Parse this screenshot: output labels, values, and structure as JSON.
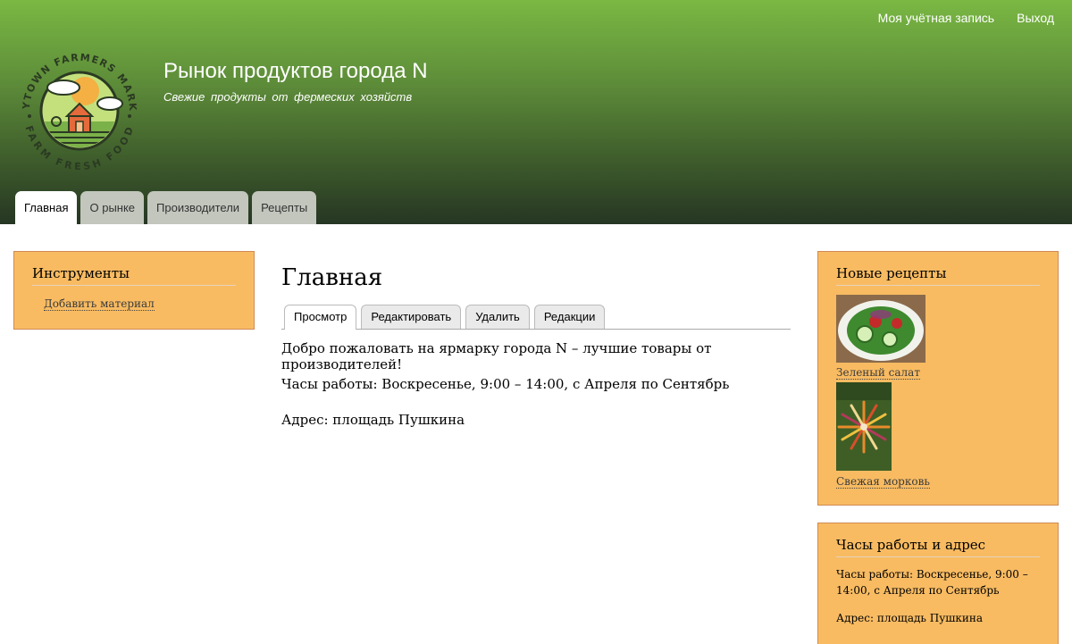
{
  "header": {
    "site_name": "Рынок продуктов города N",
    "slogan": "Свежие продукты от фермеских хозяйств",
    "logo": {
      "top_text": "ANYTOWN FARMERS MARKET",
      "bottom_text": "FARM FRESH FOOD"
    },
    "secondary_menu": [
      {
        "label": "Моя учётная запись"
      },
      {
        "label": "Выход"
      }
    ],
    "main_menu": [
      {
        "label": "Главная",
        "active": true
      },
      {
        "label": "О рынке",
        "active": false
      },
      {
        "label": "Производители",
        "active": false
      },
      {
        "label": "Рецепты",
        "active": false
      }
    ]
  },
  "sidebar_first": {
    "tools": {
      "title": "Инструменты",
      "links": [
        {
          "label": "Добавить материал"
        }
      ]
    }
  },
  "main": {
    "title": "Главная",
    "tabs": [
      {
        "label": "Просмотр",
        "active": true
      },
      {
        "label": "Редактировать",
        "active": false
      },
      {
        "label": "Удалить",
        "active": false
      },
      {
        "label": "Редакции",
        "active": false
      }
    ],
    "paragraphs": [
      "Добро пожаловать на ярмарку города N – лучшие товары от производителей!",
      "Часы работы: Воскресенье, 9:00 – 14:00, с Апреля по Сентябрь",
      "Адрес: площадь Пушкина"
    ]
  },
  "sidebar_second": {
    "recipes": {
      "title": "Новые рецепты",
      "items": [
        {
          "label": "Зеленый салат",
          "image": "salad-photo"
        },
        {
          "label": "Свежая морковь",
          "image": "carrots-photo"
        }
      ]
    },
    "hours": {
      "title": "Часы работы и адрес",
      "hours_text": "Часы работы: Воскресенье, 9:00 – 14:00, с Апреля по Сентябрь",
      "address_text": "Адрес: площадь Пушкина"
    }
  },
  "colors": {
    "header_top": "#7ab843",
    "header_bottom": "#263623",
    "block_bg": "#f8bb62",
    "block_border": "#d08a55",
    "tab_inactive": "#c2c6bd"
  }
}
